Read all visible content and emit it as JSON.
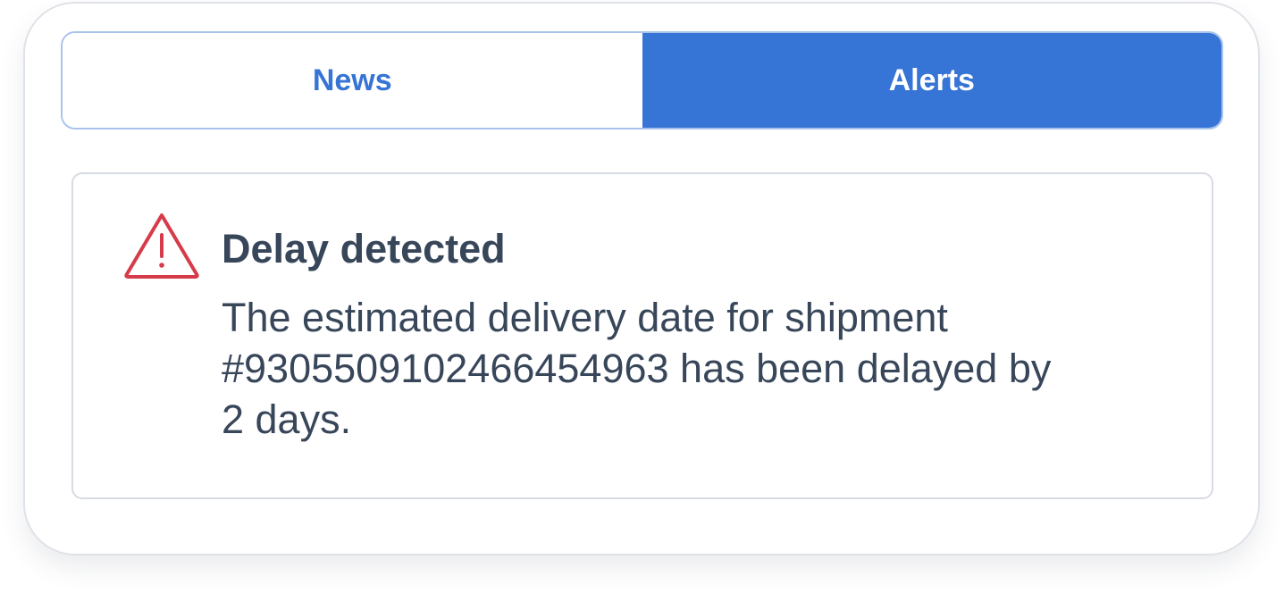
{
  "tabs": {
    "news_label": "News",
    "alerts_label": "Alerts",
    "active": "Alerts"
  },
  "alert": {
    "icon": "warning-triangle-icon",
    "title": "Delay detected",
    "message": "The estimated delivery date for shipment #93055091024664549 63 has been delayed by 2 days."
  },
  "colors": {
    "accent": "#3674d6",
    "warning": "#d63b4a",
    "text": "#38465a"
  }
}
